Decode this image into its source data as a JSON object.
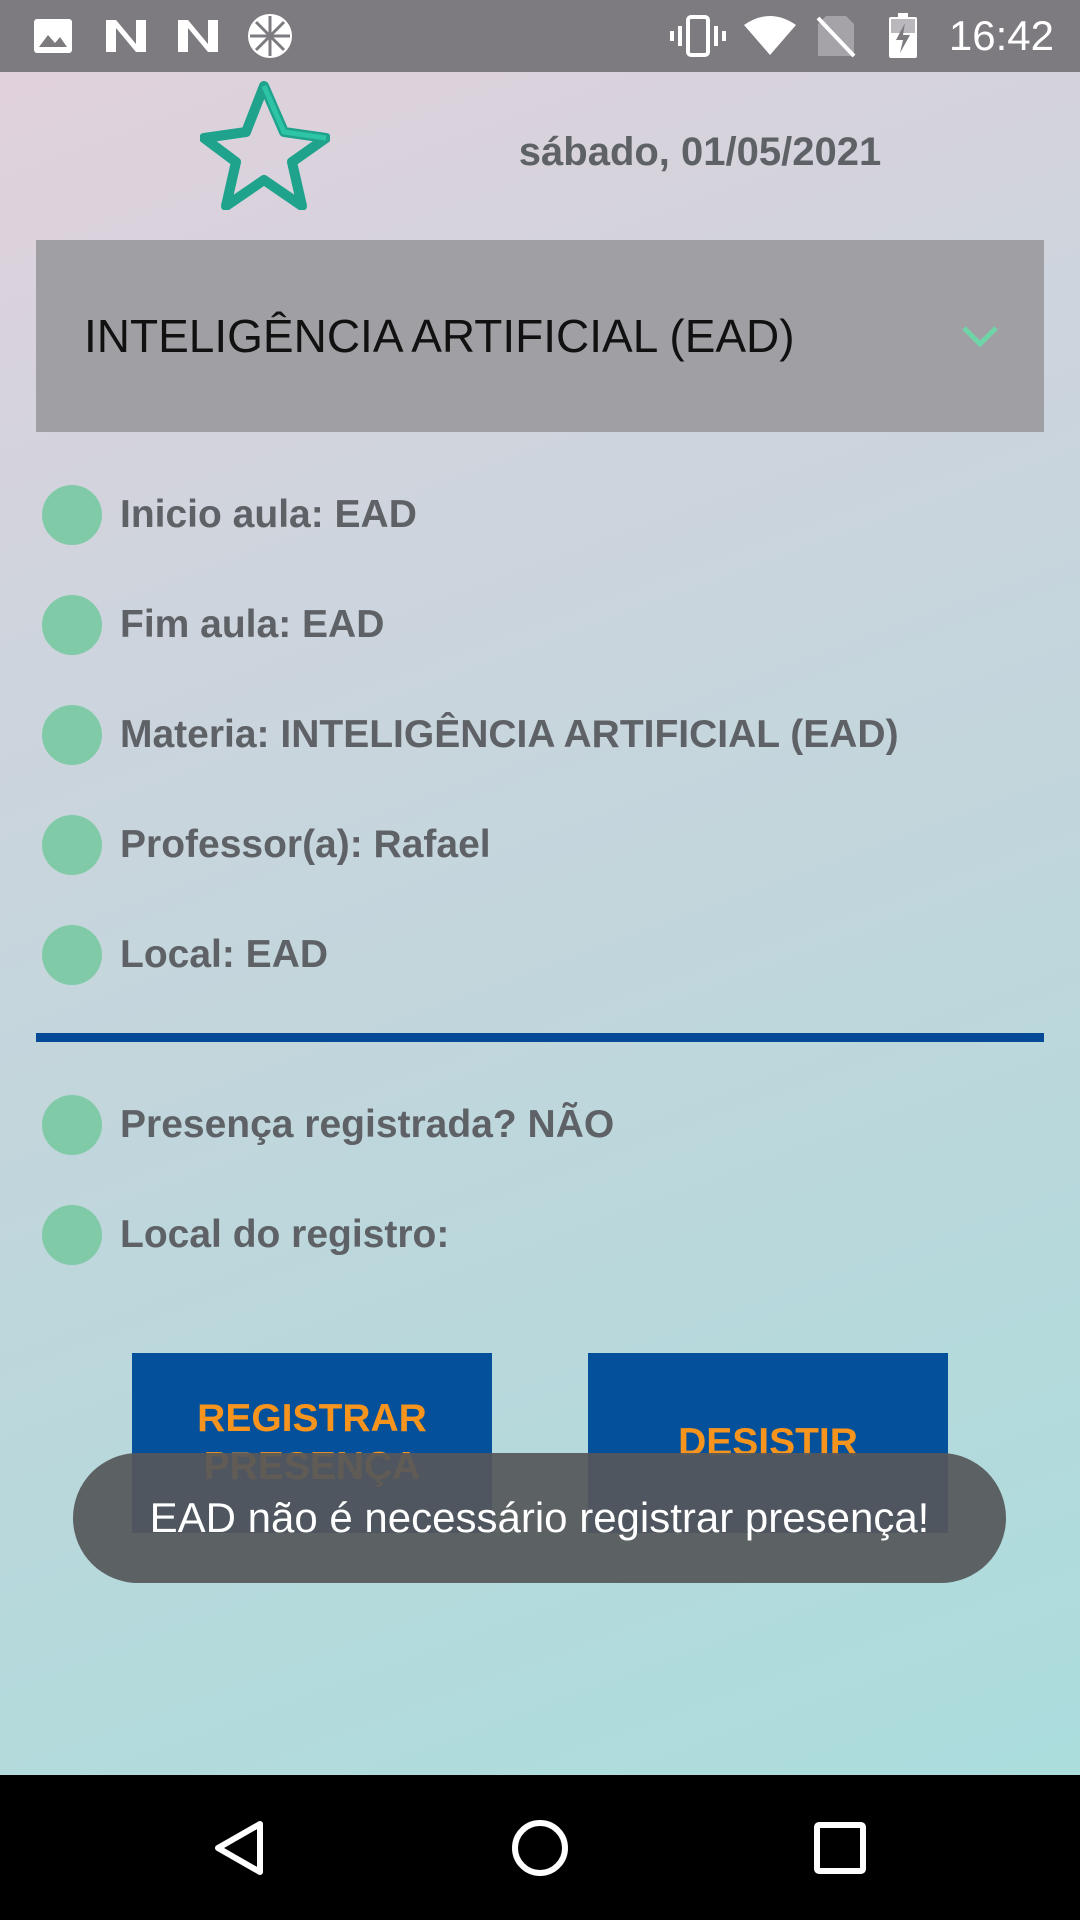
{
  "status_bar": {
    "time": "16:42",
    "left_icons": [
      "image-icon",
      "n-app-icon",
      "n-app-icon",
      "globe-app-icon"
    ],
    "right_icons": [
      "vibrate-icon",
      "wifi-icon",
      "no-sim-icon",
      "battery-charging-icon"
    ]
  },
  "header": {
    "logo_icon": "star-logo-icon",
    "date": "sábado, 01/05/2021"
  },
  "course_select": {
    "value": "INTELIGÊNCIA ARTIFICIAL (EAD)",
    "icon": "chevron-down-icon"
  },
  "class_info": [
    "Inicio aula: EAD",
    "Fim aula: EAD",
    "Materia: INTELIGÊNCIA ARTIFICIAL (EAD)",
    "Professor(a): Rafael",
    "Local: EAD"
  ],
  "attendance_info": [
    "Presença registrada? NÃO",
    "Local do registro:"
  ],
  "buttons": {
    "register_line1": "REGISTRAR",
    "register_line2": "PRESENÇA",
    "cancel": "DESISTIR"
  },
  "toast": "EAD não é necessário registrar presença!",
  "nav_bar": {
    "icons": [
      "back-icon",
      "home-icon",
      "recents-icon"
    ]
  },
  "colors": {
    "status_bar": "#7d7a80",
    "dropdown": "#a09fa4",
    "dot": "#80caa8",
    "divider": "#054a96",
    "button_bg": "#04509a",
    "button_text": "#f7941d",
    "text": "#5e6266"
  }
}
